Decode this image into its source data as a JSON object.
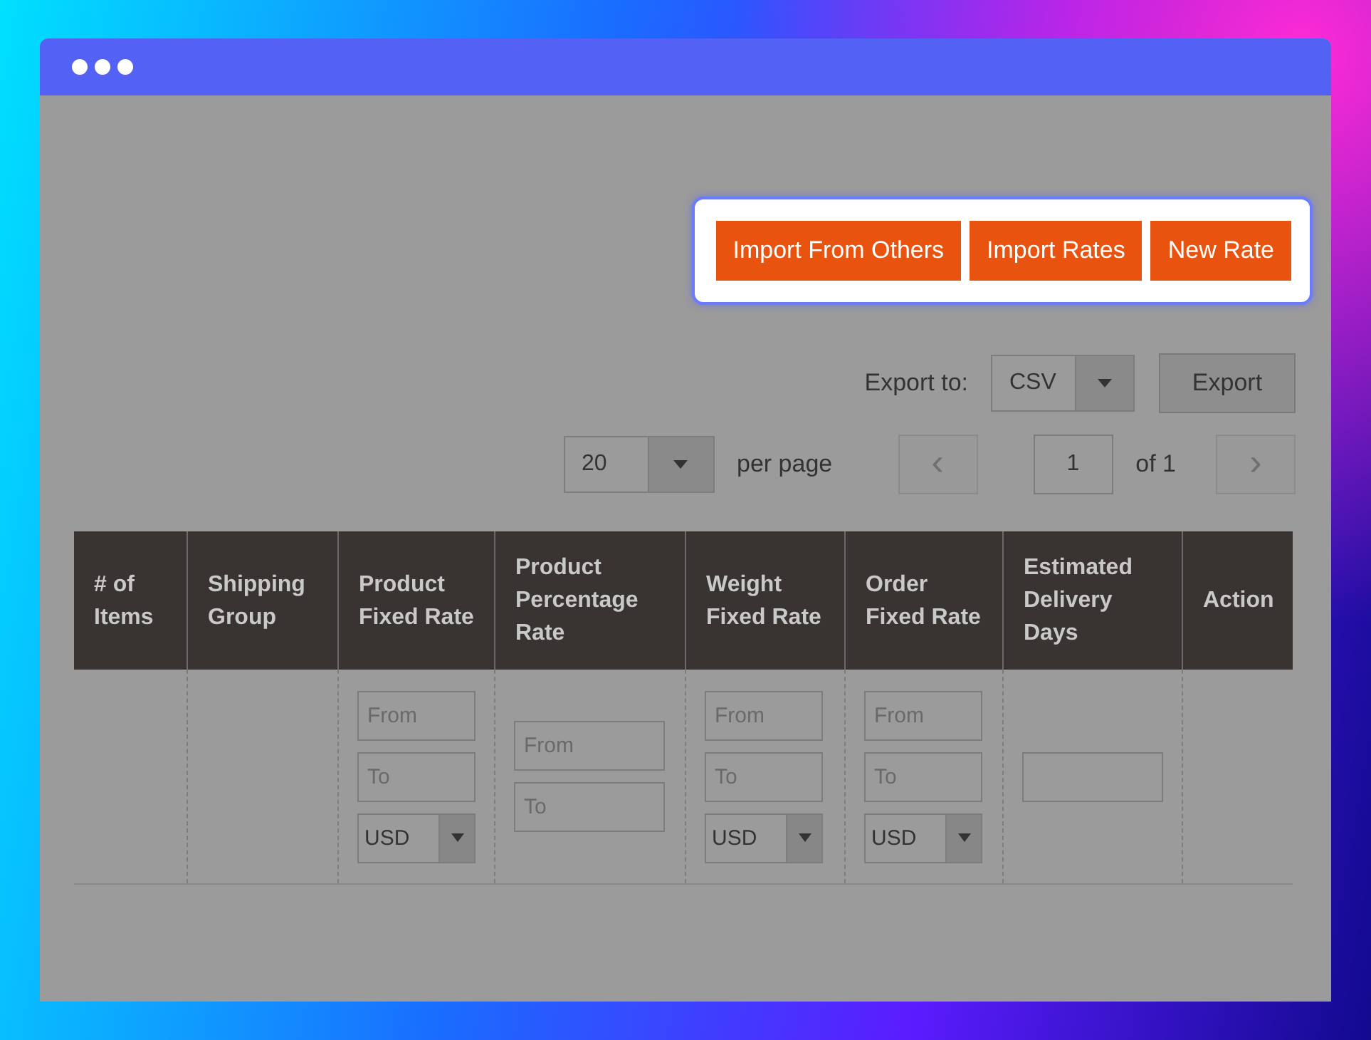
{
  "actions": [
    "Import From Others",
    "Import Rates",
    "New Rate"
  ],
  "export": {
    "label": "Export to:",
    "format": "CSV",
    "button": "Export"
  },
  "pager": {
    "page_size": "20",
    "per_page_label": "per page",
    "page": "1",
    "of_label": "of 1",
    "prev": "‹",
    "next": "›"
  },
  "table": {
    "columns": [
      {
        "header": "# of Items",
        "filter": {
          "kind": "empty"
        }
      },
      {
        "header": "Shipping Group",
        "filter": {
          "kind": "empty"
        }
      },
      {
        "header": "Product Fixed Rate",
        "filter": {
          "kind": "range",
          "from": "From",
          "to": "To",
          "currency": "USD"
        }
      },
      {
        "header": "Product Percentage Rate",
        "filter": {
          "kind": "range",
          "from": "From",
          "to": "To"
        }
      },
      {
        "header": "Weight Fixed Rate",
        "filter": {
          "kind": "range",
          "from": "From",
          "to": "To",
          "currency": "USD"
        }
      },
      {
        "header": "Order Fixed Rate",
        "filter": {
          "kind": "range",
          "from": "From",
          "to": "To",
          "currency": "USD"
        }
      },
      {
        "header": "Estimated Delivery Days",
        "filter": {
          "kind": "text"
        }
      },
      {
        "header": "Action",
        "filter": {
          "kind": "empty"
        }
      }
    ]
  }
}
